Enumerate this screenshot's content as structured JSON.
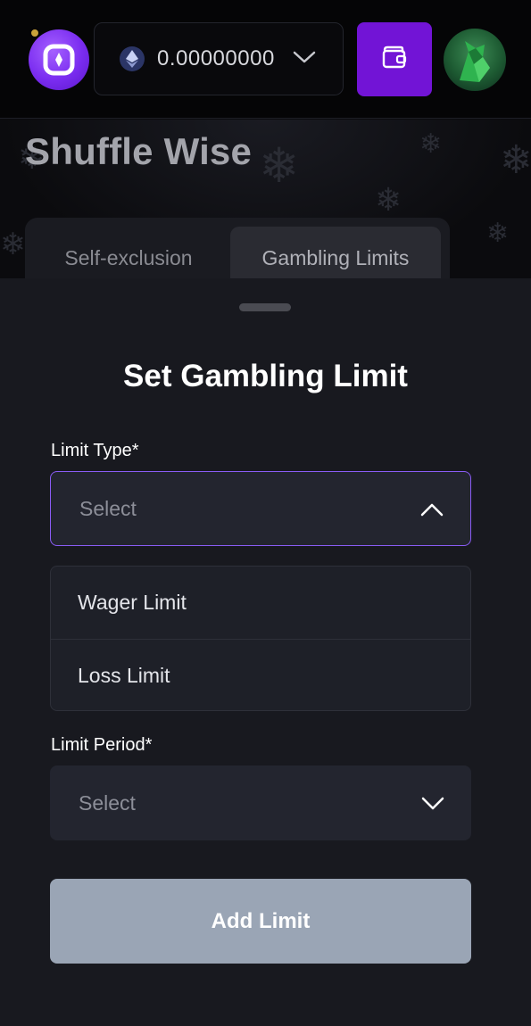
{
  "header": {
    "logo_icon": "shuffle-logo-icon",
    "balance": {
      "currency_icon": "ethereum-icon",
      "value": "0.00000000"
    },
    "wallet_icon": "wallet-icon",
    "avatar_icon": "user-avatar"
  },
  "page": {
    "title": "Shuffle Wise",
    "tabs": [
      {
        "label": "Self-exclusion"
      },
      {
        "label": "Gambling Limits"
      }
    ]
  },
  "sheet": {
    "title": "Set Gambling Limit",
    "limit_type": {
      "label": "Limit Type*",
      "placeholder": "Select",
      "options": [
        {
          "label": "Wager Limit"
        },
        {
          "label": "Loss Limit"
        }
      ]
    },
    "limit_period": {
      "label": "Limit Period*",
      "placeholder": "Select"
    },
    "add_button": "Add Limit"
  },
  "colors": {
    "accent": "#7214d6",
    "focus_border": "#8a5cf5",
    "disabled_button": "#9aa5b5"
  }
}
